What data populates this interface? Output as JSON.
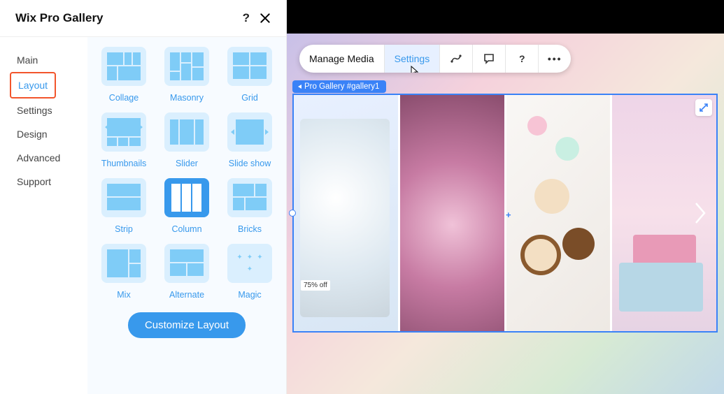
{
  "panel": {
    "title": "Wix Pro Gallery",
    "sidebar": [
      {
        "label": "Main"
      },
      {
        "label": "Layout"
      },
      {
        "label": "Settings"
      },
      {
        "label": "Design"
      },
      {
        "label": "Advanced"
      },
      {
        "label": "Support"
      }
    ],
    "active_sidebar_index": 1,
    "layouts": [
      {
        "label": "Collage"
      },
      {
        "label": "Masonry"
      },
      {
        "label": "Grid"
      },
      {
        "label": "Thumbnails"
      },
      {
        "label": "Slider"
      },
      {
        "label": "Slide show"
      },
      {
        "label": "Strip"
      },
      {
        "label": "Column"
      },
      {
        "label": "Bricks"
      },
      {
        "label": "Mix"
      },
      {
        "label": "Alternate"
      },
      {
        "label": "Magic"
      }
    ],
    "selected_layout_index": 7,
    "customize_label": "Customize Layout"
  },
  "toolbar": {
    "manage_label": "Manage Media",
    "settings_label": "Settings"
  },
  "breadcrumb": {
    "label": "Pro Gallery #gallery1"
  },
  "gallery": {
    "sale_text": "75% off"
  }
}
